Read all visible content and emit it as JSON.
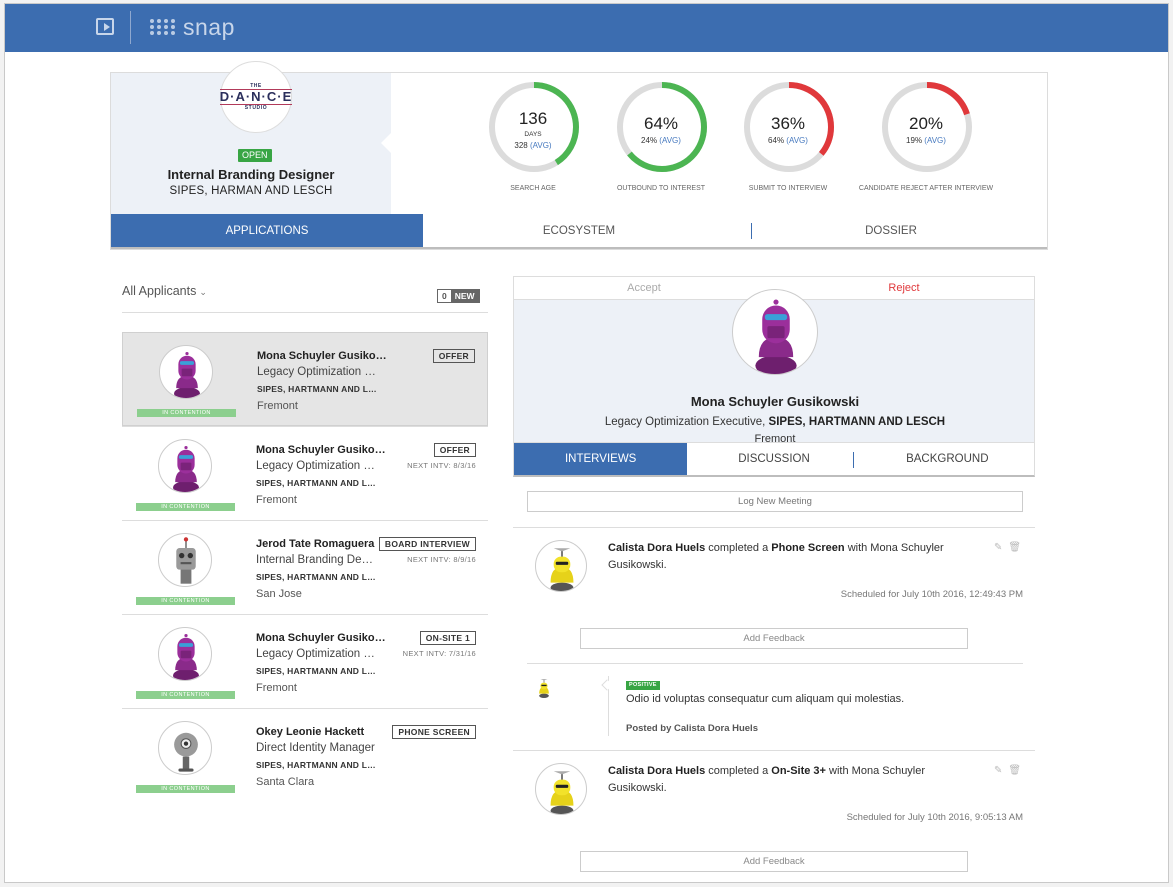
{
  "app": {
    "brand": "snap"
  },
  "job": {
    "logo": {
      "line1": "THE",
      "line2": "D·A·N·C·E",
      "line3": "STUDIO"
    },
    "status": "OPEN",
    "title": "Internal Branding Designer",
    "company": "SIPES, HARMAN AND LESCH",
    "metrics": [
      {
        "value": "136",
        "unit": "DAYS",
        "avg": "328",
        "avg_label": "(AVG)",
        "caption": "SEARCH AGE",
        "fraction": 0.41,
        "color": "#4cb552"
      },
      {
        "value": "64%",
        "avg": "24%",
        "avg_label": "(AVG)",
        "caption": "OUTBOUND TO INTEREST",
        "fraction": 0.64,
        "color": "#4cb552"
      },
      {
        "value": "36%",
        "avg": "64%",
        "avg_label": "(AVG)",
        "caption": "SUBMIT TO INTERVIEW",
        "fraction": 0.36,
        "color": "#e0383b"
      },
      {
        "value": "20%",
        "avg": "19%",
        "avg_label": "(AVG)",
        "caption": "CANDIDATE REJECT AFTER INTERVIEW",
        "fraction": 0.2,
        "color": "#e0383b"
      }
    ],
    "tabs": [
      "APPLICATIONS",
      "ECOSYSTEM",
      "DOSSIER"
    ],
    "active_tab": 0
  },
  "list": {
    "filter_label": "All Applicants",
    "new_count": "0",
    "new_label": "NEW",
    "contention_label": "IN CONTENTION",
    "applicants": [
      {
        "name": "Mona Schuyler Gusikowski",
        "role": "Legacy Optimization Executive",
        "company": "SIPES, HARTMANN AND LESCH",
        "location": "Fremont",
        "stage": "OFFER",
        "next": "",
        "avatar": "purple"
      },
      {
        "name": "Mona Schuyler Gusikowski",
        "role": "Legacy Optimization Executive",
        "company": "SIPES, HARTMANN AND LESCH",
        "location": "Fremont",
        "stage": "OFFER",
        "next": "NEXT INTV: 8/3/16",
        "avatar": "purple"
      },
      {
        "name": "Jerod Tate Romaguera",
        "role": "Internal Branding Designer",
        "company": "SIPES, HARTMANN AND LESCH",
        "location": "San Jose",
        "stage": "BOARD INTERVIEW",
        "next": "NEXT INTV: 8/9/16",
        "avatar": "gray-tall"
      },
      {
        "name": "Mona Schuyler Gusikowski",
        "role": "Legacy Optimization Executive",
        "company": "SIPES, HARTMANN AND LESCH",
        "location": "Fremont",
        "stage": "ON-SITE 1",
        "next": "NEXT INTV: 7/31/16",
        "avatar": "purple"
      },
      {
        "name": "Okey Leonie Hackett",
        "role": "Direct Identity Manager",
        "company": "SIPES, HARTMANN AND LESCH",
        "location": "Santa Clara",
        "stage": "PHONE SCREEN",
        "next": "",
        "avatar": "gray-dome"
      }
    ]
  },
  "detail": {
    "accept_label": "Accept",
    "reject_label": "Reject",
    "name": "Mona Schuyler Gusikowski",
    "role": "Legacy Optimization Executive,",
    "company": "SIPES, HARTMANN AND LESCH",
    "location": "Fremont",
    "tabs": [
      "INTERVIEWS",
      "DISCUSSION",
      "BACKGROUND"
    ],
    "active_tab": 0,
    "log_meeting_label": "Log New Meeting",
    "add_feedback_label": "Add Feedback",
    "activities": [
      {
        "actor": "Calista Dora Huels",
        "verb": "completed a",
        "event": "Phone Screen",
        "with": "with Mona Schuyler",
        "with2": "Gusikowski.",
        "scheduled": "Scheduled for July 10th 2016, 12:49:43 PM"
      },
      {
        "actor": "Calista Dora Huels",
        "verb": "completed a",
        "event": "On-Site 3+",
        "with": "with Mona Schuyler",
        "with2": "Gusikowski.",
        "scheduled": "Scheduled for July 10th 2016, 9:05:13 AM"
      }
    ],
    "feedback": {
      "badge": "POSITIVE",
      "text": "Odio id voluptas consequatur cum aliquam qui molestias.",
      "author": "Posted by Calista Dora Huels"
    }
  }
}
